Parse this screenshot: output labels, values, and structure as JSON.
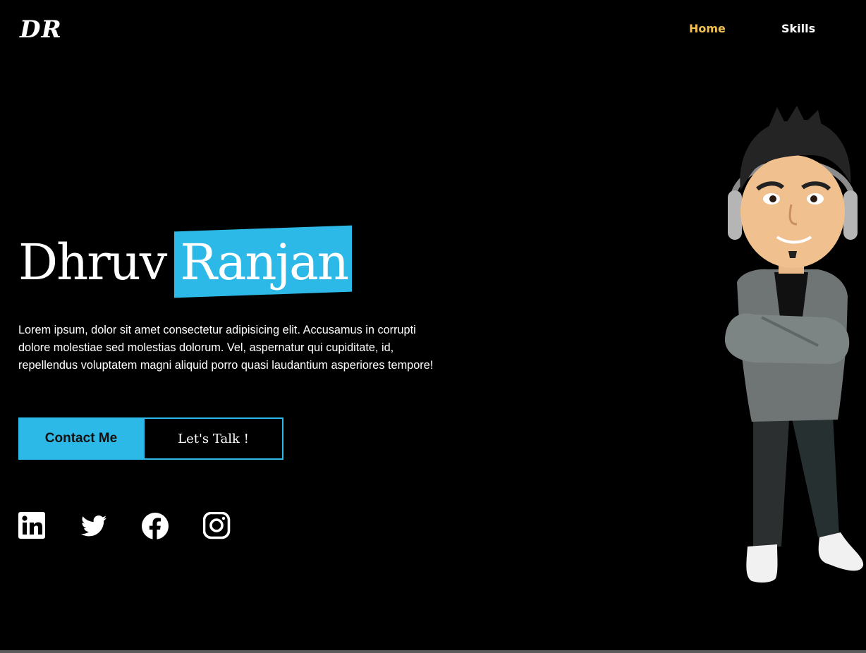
{
  "header": {
    "logo": "DR",
    "nav": [
      {
        "label": "Home",
        "active": true
      },
      {
        "label": "Skills",
        "active": false
      }
    ]
  },
  "hero": {
    "first_name": "Dhruv",
    "last_name": "Ranjan",
    "intro": "Lorem ipsum, dolor sit amet consectetur adipisicing elit. Accusamus in corrupti dolore molestiae sed molestias dolorum. Vel, aspernatur qui cupiditate, id, repellendus voluptatem magni aliquid porro quasi laudantium asperiores tempore!",
    "buttons": {
      "contact": "Contact Me",
      "talk": "Let's Talk !"
    }
  },
  "social": [
    {
      "name": "linkedin-icon"
    },
    {
      "name": "twitter-icon"
    },
    {
      "name": "facebook-icon"
    },
    {
      "name": "instagram-icon"
    }
  ],
  "colors": {
    "background": "#000000",
    "accent": "#2db9e7",
    "nav_active": "#f2c04f",
    "text": "#ffffff"
  }
}
